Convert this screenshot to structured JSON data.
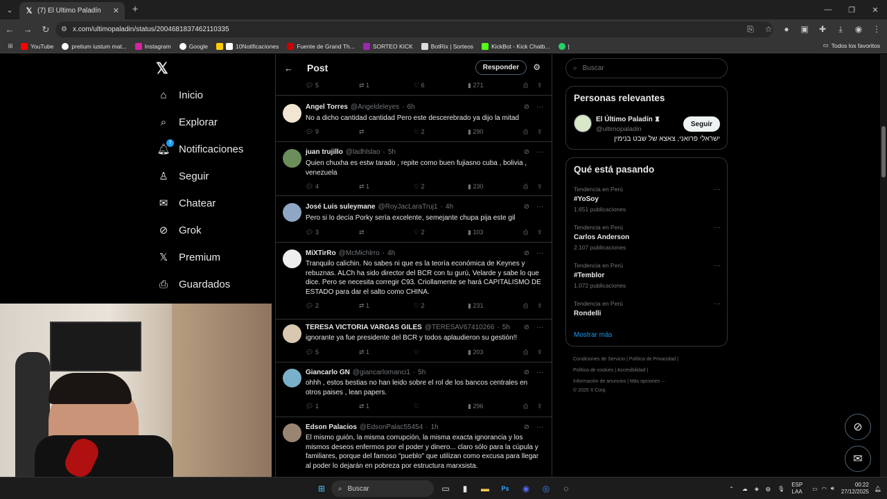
{
  "browser": {
    "tab_title": "(7) El Último Paladín",
    "url": "x.com/ultimopaladin/status/2004681837462110335",
    "bookmarks": [
      "YouTube",
      "pretium iustum mat...",
      "Instagram",
      "Google",
      "10Notificaciones",
      "Fuente de Grand Th...",
      "SORTEO KICK",
      "BotRix | Sorteos",
      "KickBot - Kick Chatb..."
    ],
    "all_bookmarks": "Todos los favoritos"
  },
  "nav": {
    "items": [
      "Inicio",
      "Explorar",
      "Notificaciones",
      "Seguir",
      "Chatear",
      "Grok",
      "Premium",
      "Guardados"
    ],
    "notif_badge": "7"
  },
  "post_header": {
    "title": "Post",
    "reply_label": "Responder"
  },
  "top_stats": {
    "replies": "5",
    "reposts": "1",
    "likes": "6",
    "views": "271"
  },
  "tweets": [
    {
      "name": "Angel Torres",
      "handle": "@Angeldeleyes",
      "time": "6h",
      "text": "No a dicho cantidad cantidad  Pero este descerebrado ya dijo la mitad",
      "replies": "9",
      "reposts": "",
      "likes": "2",
      "views": "290"
    },
    {
      "name": "juan trujillo",
      "handle": "@ladhlslao",
      "time": "5h",
      "text": "Quien chuxha es estw tarado , repite como buen fujiasno cuba , bolivia , venezuela",
      "replies": "4",
      "reposts": "1",
      "likes": "2",
      "views": "230"
    },
    {
      "name": "José Luis suleymane",
      "handle": "@RoyJacLaraTruj1",
      "time": "4h",
      "text": "Pero si lo decía Porky sería excelente, semejante chupa pija este gil",
      "replies": "3",
      "reposts": "",
      "likes": "2",
      "views": "103"
    },
    {
      "name": "MiXTirRo",
      "handle": "@McMichlrro",
      "time": "4h",
      "text": "Tranquilo calichin. No sabes ni que es la teoría económica de Keynes y rebuznas. ALCh ha sido director del BCR con tu gurú, Velarde y sabe lo que dice. Pero se necesita corregir C93. Criollamente se hará CAPITALISMO DE ESTADO para dar el salto como CHINA.",
      "replies": "2",
      "reposts": "1",
      "likes": "2",
      "views": "231"
    },
    {
      "name": "TERESA VICTORIA VARGAS GILES",
      "handle": "@TERESAV67410266",
      "time": "5h",
      "text": "ignorante ya fue presidente del BCR y todos aplaudieron su gestión!!",
      "replies": "5",
      "reposts": "1",
      "likes": "",
      "views": "203"
    },
    {
      "name": "Giancarlo GN",
      "handle": "@giancarlomanci1",
      "time": "5h",
      "text": "ohhh , estos bestias no han leido sobre el rol de los bancos centrales en otros paises , lean papers.",
      "replies": "1",
      "reposts": "1",
      "likes": "",
      "views": "296"
    },
    {
      "name": "Edson Palacios",
      "handle": "@EdsonPalac55454",
      "time": "1h",
      "text": "El mismo guión, la misma corrupción, la misma exacta ignorancia y los mismos deseos enfermos por el poder y dinero... claro sólo para la cúpula y familiares, porque del famoso \"pueblo\" que utilizan como excusa para llegar al poder lo dejarán en pobreza por estructura marxsista."
    }
  ],
  "search": {
    "placeholder": "Buscar"
  },
  "relevant": {
    "title": "Personas relevantes",
    "name": "El Último Paladín",
    "handle": "@ultimopaladin",
    "bio": "ישראלי פרואני, צאצא של שבט בנימין",
    "follow_label": "Seguir"
  },
  "trending": {
    "title": "Qué está pasando",
    "items": [
      {
        "context": "Tendencia en Perú",
        "name": "#YoSoy",
        "posts": "1.651 publicaciones"
      },
      {
        "context": "Tendencia en Perú",
        "name": "Carlos Anderson",
        "posts": "2.107 publicaciones"
      },
      {
        "context": "Tendencia en Perú",
        "name": "#Temblor",
        "posts": "1.072 publicaciones"
      },
      {
        "context": "Tendencia en Perú",
        "name": "Rondelli",
        "posts": ""
      }
    ],
    "show_more": "Mostrar más"
  },
  "footer": {
    "line1": "Condiciones de Servicio  |  Política de Privacidad  |",
    "line2": "Política de cookies  |  Accesibilidad  |",
    "line3": "Información de anuncios  |  Más opciones ···",
    "line4": "© 2025 X Corp."
  },
  "taskbar": {
    "search": "Buscar",
    "lang1": "ESP",
    "lang2": "LAA",
    "time": "00:22",
    "date": "27/12/2025"
  }
}
